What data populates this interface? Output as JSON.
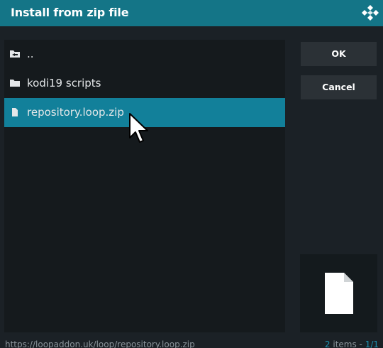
{
  "dialog": {
    "title": "Install from zip file",
    "logo_icon": "kodi-logo-icon"
  },
  "file_list": {
    "items": [
      {
        "label": "..",
        "icon": "parent-folder-icon",
        "selected": false
      },
      {
        "label": "kodi19 scripts",
        "icon": "folder-icon",
        "selected": false
      },
      {
        "label": "repository.loop.zip",
        "icon": "file-icon",
        "selected": true
      }
    ]
  },
  "buttons": {
    "ok_label": "OK",
    "cancel_label": "Cancel"
  },
  "preview": {
    "icon": "file-icon"
  },
  "footer": {
    "path": "https://loopaddon.uk/loop/repository.loop.zip",
    "count_number": "2",
    "count_items": " items - ",
    "count_page": "1/1"
  },
  "colors": {
    "titlebar": "#147587",
    "selected": "#12809a",
    "accent": "#1c8fb0"
  }
}
